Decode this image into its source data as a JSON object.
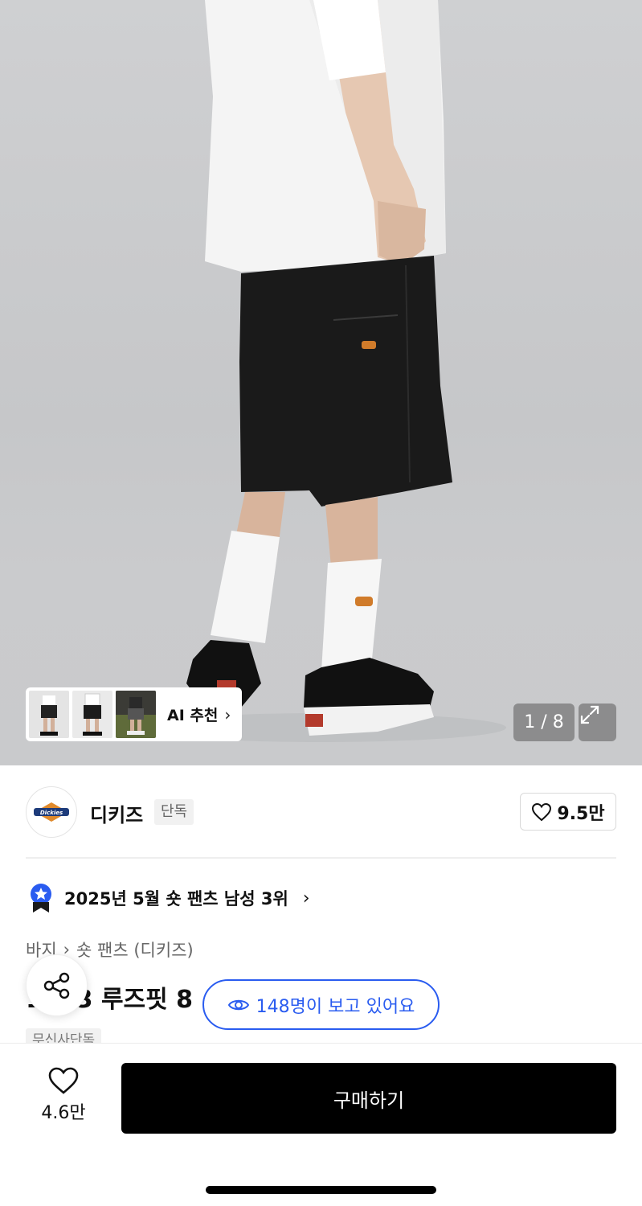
{
  "hero": {
    "ai_recommend_label": "AI 추천",
    "image_counter": "1 / 8"
  },
  "brand": {
    "name": "디키즈",
    "tag": "단독",
    "like_count": "9.5만",
    "logo_text": "Dickies"
  },
  "ranking": {
    "text": "2025년 5월 숏 팬츠 남성 3위"
  },
  "breadcrumb": {
    "items": [
      "바지",
      "숏 팬츠 (디키즈)"
    ]
  },
  "product": {
    "title": "1333 루즈핏 8",
    "exclusive_badge": "무신사단독"
  },
  "viewers": {
    "text": "148명이 보고 있어요"
  },
  "bottom_bar": {
    "like_count": "4.6만",
    "buy_label": "구매하기"
  },
  "colors": {
    "accent_blue": "#2a5cf0",
    "buy_button": "#000000"
  }
}
